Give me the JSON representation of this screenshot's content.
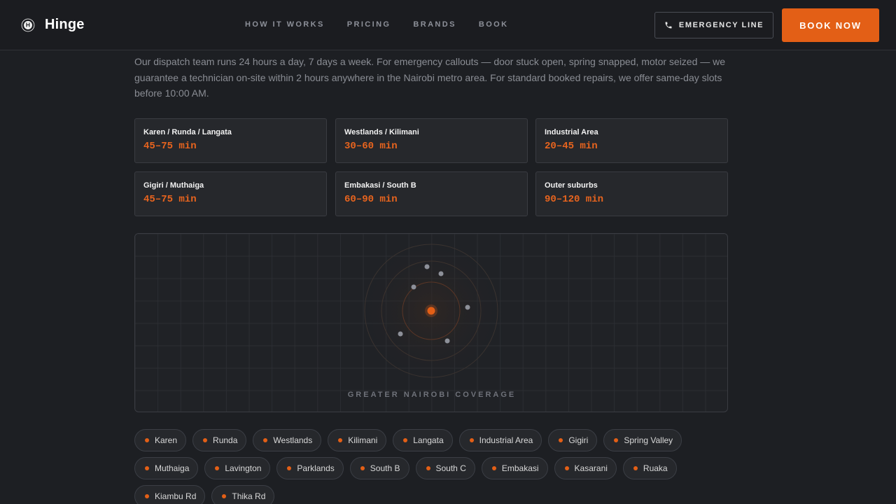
{
  "brand": {
    "name": "Hinge",
    "mark": "H"
  },
  "nav": {
    "items": [
      {
        "label": "HOW IT WORKS"
      },
      {
        "label": "PRICING"
      },
      {
        "label": "BRANDS"
      },
      {
        "label": "BOOK"
      }
    ]
  },
  "header": {
    "emergency_label": "EMERGENCY LINE",
    "book_label": "BOOK NOW"
  },
  "intro": {
    "text": "Our dispatch team runs 24 hours a day, 7 days a week. For emergency callouts — door stuck open, spring snapped, motor seized — we guarantee a technician on-site within 2 hours anywhere in the Nairobi metro area. For standard booked repairs, we offer same-day slots before 10:00 AM."
  },
  "zones": [
    {
      "name": "Karen / Runda / Langata",
      "time": "45–75 min"
    },
    {
      "name": "Westlands / Kilimani",
      "time": "30–60 min"
    },
    {
      "name": "Industrial Area",
      "time": "20–45 min"
    },
    {
      "name": "Gigiri / Muthaiga",
      "time": "45–75 min"
    },
    {
      "name": "Embakasi / South B",
      "time": "60–90 min"
    },
    {
      "name": "Outer suburbs",
      "time": "90–120 min"
    }
  ],
  "map": {
    "caption": "GREATER NAIROBI COVERAGE"
  },
  "areas": {
    "row1": [
      "Karen",
      "Runda",
      "Westlands",
      "Kilimani",
      "Langata",
      "Industrial Area",
      "Gigiri",
      "Spring Valley"
    ],
    "row2": [
      "Muthaiga",
      "Lavington",
      "Parklands",
      "South B",
      "South C",
      "Embakasi",
      "Kasarani",
      "Ruaka"
    ],
    "row3": [
      "Kiambu Rd",
      "Thika Rd"
    ]
  },
  "colors": {
    "accent": "#e35f16",
    "background": "#1d1f23",
    "card": "#26282c"
  },
  "icons": {
    "phone": "phone-icon",
    "brand": "brand-logo-icon"
  }
}
